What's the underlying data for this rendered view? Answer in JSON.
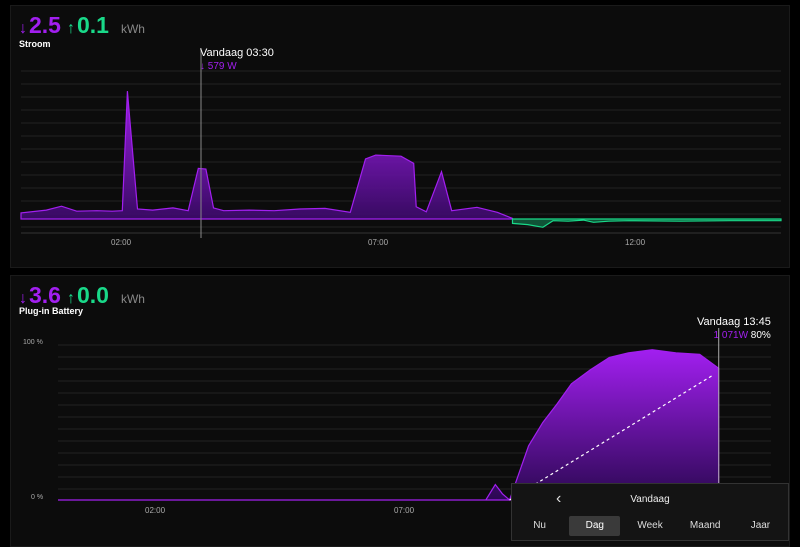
{
  "stroom": {
    "import_value": "2.5",
    "export_value": "0.1",
    "unit": "kWh",
    "title": "Stroom",
    "tooltip": {
      "time": "Vandaag 03:30",
      "value": "579 W"
    },
    "x_ticks": [
      "02:00",
      "07:00",
      "12:00"
    ]
  },
  "battery": {
    "import_value": "3.6",
    "export_value": "0.0",
    "unit": "kWh",
    "title": "Plug-in Battery",
    "tooltip": {
      "time": "Vandaag 13:45",
      "power": "1 071W",
      "soc": "80%"
    },
    "y_ticks": [
      "100 %",
      "0 %"
    ],
    "x_ticks": [
      "02:00",
      "07:00"
    ]
  },
  "range_picker": {
    "current": "Vandaag",
    "tabs": [
      "Nu",
      "Dag",
      "Week",
      "Maand",
      "Jaar"
    ],
    "active": "Dag"
  },
  "colors": {
    "import": "#a21ff0",
    "export": "#19d989",
    "background": "#0c0c0c"
  },
  "icons": {
    "down": "arrow-down-icon",
    "up": "arrow-up-icon",
    "back": "chevron-left-icon"
  },
  "chart_data": [
    {
      "type": "area",
      "title": "Stroom",
      "x_unit": "hour",
      "x_range": [
        0,
        15
      ],
      "series": [
        {
          "values": [
            [
              0.0,
              110
            ],
            [
              0.5,
              160
            ],
            [
              0.8,
              230
            ],
            [
              1.1,
              140
            ],
            [
              1.5,
              150
            ],
            [
              1.8,
              140
            ],
            [
              2.0,
              150
            ],
            [
              2.1,
              2300
            ],
            [
              2.3,
              180
            ],
            [
              2.6,
              160
            ],
            [
              3.0,
              200
            ],
            [
              3.3,
              150
            ],
            [
              3.5,
              910
            ],
            [
              3.65,
              900
            ],
            [
              3.8,
              200
            ],
            [
              4.0,
              150
            ],
            [
              4.5,
              160
            ],
            [
              5.0,
              150
            ],
            [
              5.5,
              180
            ],
            [
              6.0,
              190
            ],
            [
              6.5,
              120
            ],
            [
              6.8,
              1080
            ],
            [
              7.0,
              1150
            ],
            [
              7.5,
              1130
            ],
            [
              7.75,
              1000
            ],
            [
              7.8,
              220
            ],
            [
              8.0,
              130
            ],
            [
              8.3,
              850
            ],
            [
              8.5,
              150
            ],
            [
              9.0,
              210
            ],
            [
              9.4,
              120
            ],
            [
              9.7,
              10
            ]
          ]
        },
        {
          "values": [
            [
              9.7,
              -80
            ],
            [
              10.0,
              -100
            ],
            [
              10.3,
              -150
            ],
            [
              10.5,
              -30
            ],
            [
              10.8,
              -40
            ],
            [
              11.1,
              -20
            ],
            [
              11.3,
              -60
            ],
            [
              11.6,
              -40
            ],
            [
              12.0,
              -30
            ],
            [
              13.0,
              -40
            ],
            [
              14.0,
              -30
            ],
            [
              15.0,
              -30
            ]
          ]
        }
      ]
    },
    {
      "type": "area",
      "title": "Plug-in Battery",
      "x_unit": "hour",
      "x_range": [
        0,
        15
      ],
      "y_range": [
        0,
        100
      ],
      "series": [
        {
          "name": "power",
          "values": [
            [
              0,
              0
            ],
            [
              9.0,
              0
            ],
            [
              9.2,
              10
            ],
            [
              9.35,
              4
            ],
            [
              9.5,
              0
            ],
            [
              9.9,
              35
            ],
            [
              10.2,
              50
            ],
            [
              10.5,
              62
            ],
            [
              10.8,
              75
            ],
            [
              11.2,
              84
            ],
            [
              11.6,
              92
            ],
            [
              12.0,
              95
            ],
            [
              12.5,
              97
            ],
            [
              13.0,
              95
            ],
            [
              13.5,
              94
            ],
            [
              13.9,
              85
            ]
          ]
        },
        {
          "name": "soc",
          "values": [
            [
              9.5,
              0
            ],
            [
              13.75,
              80
            ]
          ]
        }
      ]
    }
  ]
}
